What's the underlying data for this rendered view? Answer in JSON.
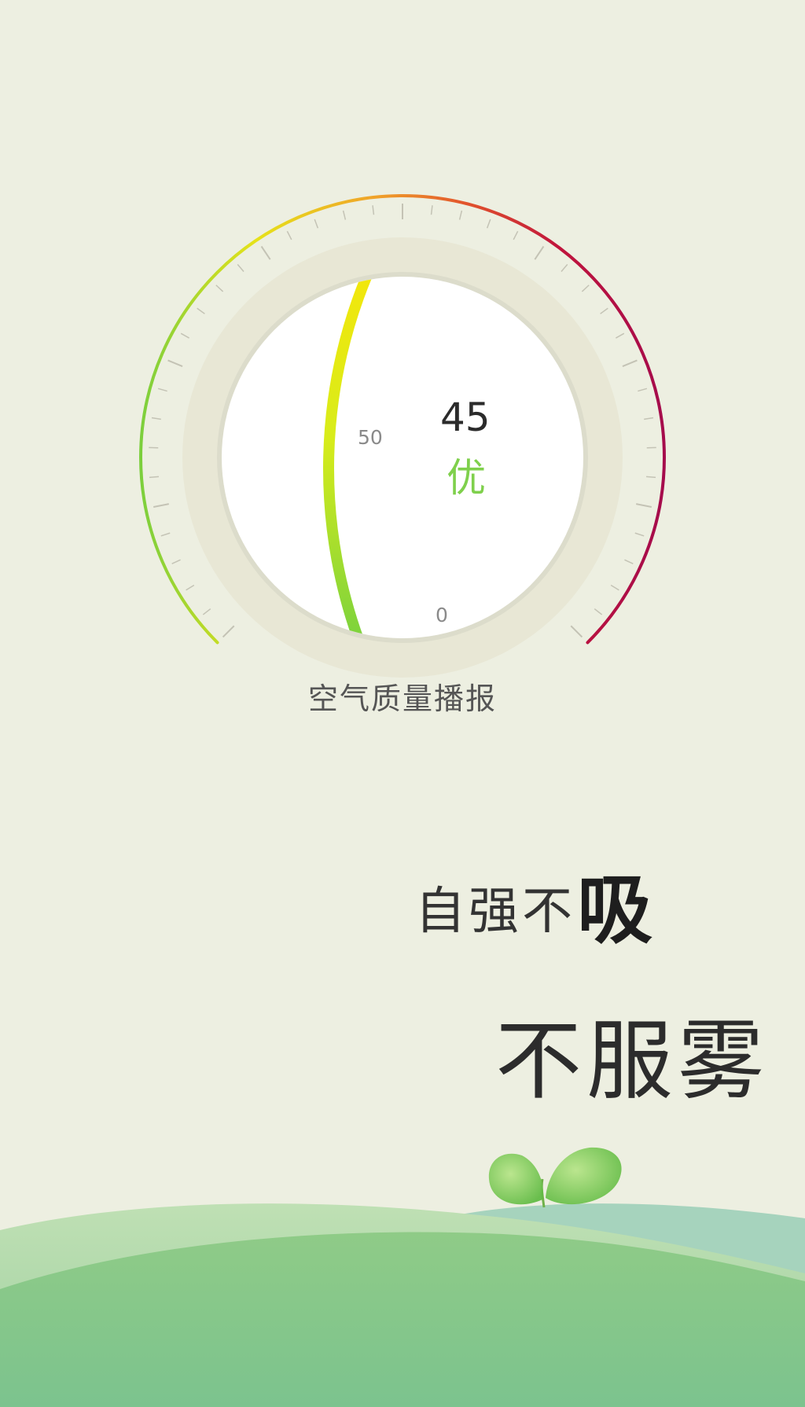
{
  "gauge": {
    "aqi_value": "45",
    "aqi_level": "优",
    "aqi_level_color": "#7fd04c",
    "scale_label_50": "50",
    "scale_label_0": "0",
    "outer_arc_colors": [
      "#7ccf3d",
      "#e6e21a",
      "#f0a22a",
      "#e2542c",
      "#c0143c",
      "#a50b4c"
    ],
    "inner_arc_colors": [
      "#74d040",
      "#d8ec1a",
      "#f5e60a"
    ],
    "aqi_fraction_of_inner_scale": 0.45
  },
  "caption": "空气质量播报",
  "slogan": {
    "line1": "自强不",
    "emphasis": "吸",
    "line2": "不服雾"
  },
  "decorations": {
    "sprout": "sprout-icon",
    "hills": "hills-illustration"
  }
}
